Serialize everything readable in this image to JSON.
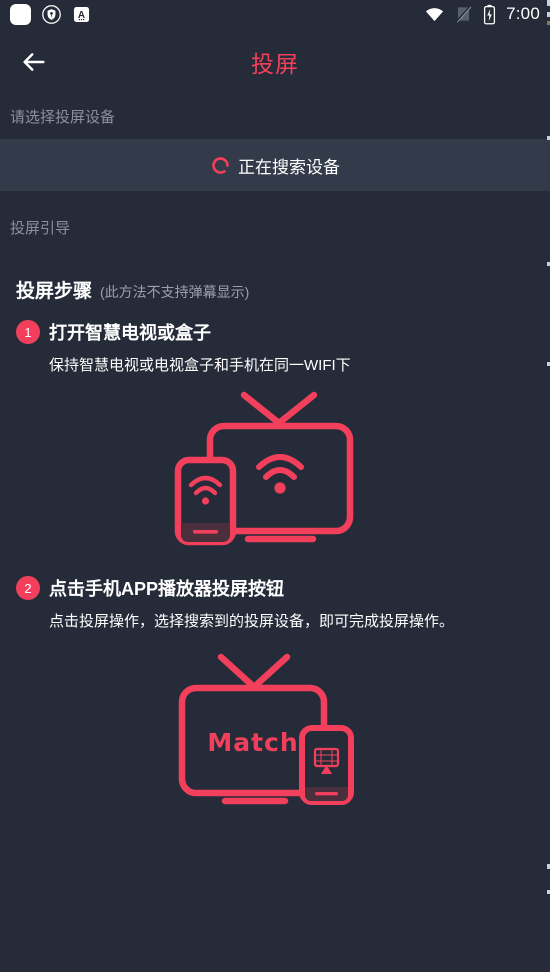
{
  "status_bar": {
    "left_icons": [
      "app-square-icon",
      "shield-icon",
      "text-box-icon"
    ],
    "right_icons": [
      "wifi-icon",
      "no-sim-icon",
      "battery-charging-icon"
    ],
    "time": "7:00"
  },
  "nav": {
    "back_icon": "back-arrow-icon",
    "title": "投屏",
    "title_color": "#f2405c"
  },
  "device_picker": {
    "label": "请选择投屏设备",
    "searching_text": "正在搜索设备",
    "spinner_icon": "loading-spinner-icon",
    "accent_color": "#f2405c"
  },
  "guide": {
    "section_label": "投屏引导",
    "steps_heading": "投屏步骤",
    "steps_heading_note": "(此方法不支持弹幕显示)",
    "steps": [
      {
        "number": "1",
        "title": "打开智慧电视或盒子",
        "desc": "保持智慧电视或电视盒子和手机在同一WIFI下",
        "illustration": "tv-phone-wifi-illustration"
      },
      {
        "number": "2",
        "title": "点击手机APP播放器投屏按钮",
        "desc": "点击投屏操作，选择搜索到的投屏设备，即可完成投屏操作。",
        "illustration": "tv-match-phone-cast-illustration",
        "tv_screen_text": "Match",
        "phone_cast_icon_label": "投屏"
      }
    ]
  },
  "theme": {
    "background": "#262b39",
    "panel": "#333a4a",
    "accent": "#f2405c",
    "muted_text": "#8a90a0",
    "primary_text": "#ffffff"
  }
}
